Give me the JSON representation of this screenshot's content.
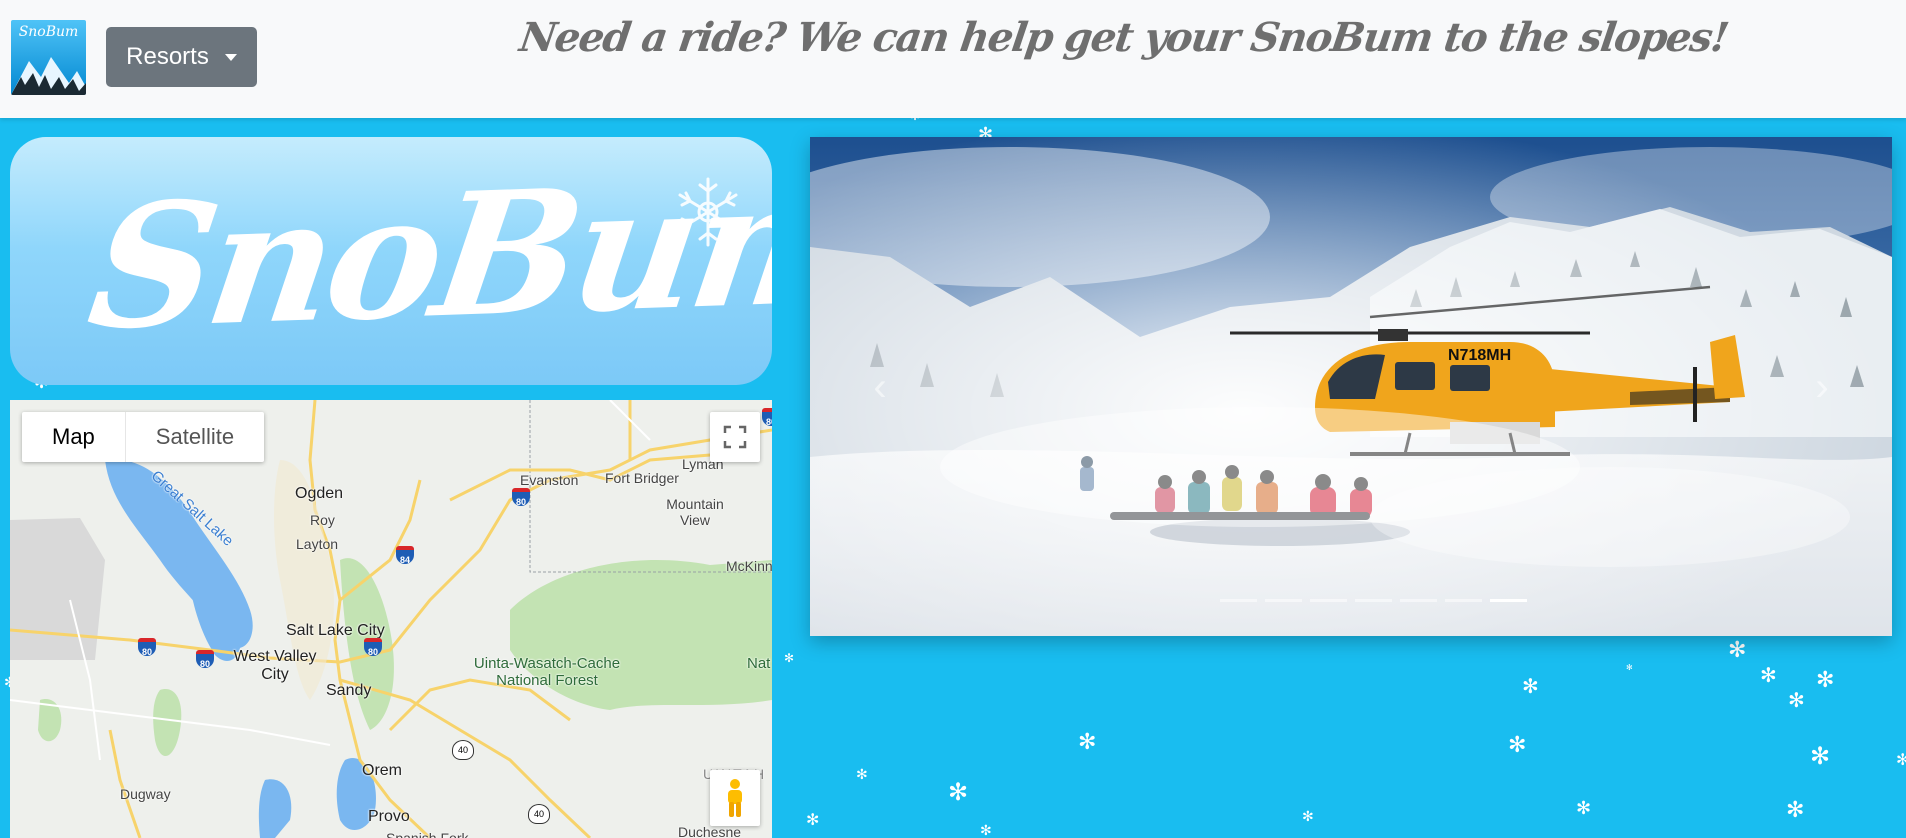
{
  "navbar": {
    "logo_text": "SnoBum",
    "resorts_label": "Resorts",
    "tagline": "Need a ride? We can help get your SnoBum to the slopes!"
  },
  "brand": {
    "name": "SnoBum"
  },
  "map": {
    "type_buttons": [
      "Map",
      "Satellite"
    ],
    "active_type": "Map",
    "labels": {
      "great_salt_lake": "Great Salt Lake",
      "ogden": "Ogden",
      "roy": "Roy",
      "layton": "Layton",
      "evanston": "Evanston",
      "fort_bridger": "Fort Bridger",
      "lyman": "Lyman",
      "mountain_view": "Mountain View",
      "mckinnon": "McKinn",
      "salt_lake_city": "Salt Lake City",
      "west_valley_city": "West Valley City",
      "sandy": "Sandy",
      "forest": "Uinta-Wasatch-Cache National Forest",
      "nat": "Nat",
      "orem": "Orem",
      "provo": "Provo",
      "dugway": "Dugway",
      "uintah": "UINTAH",
      "duchesne": "Duchesne",
      "spanish_fork": "Spanish Fork"
    },
    "shields": {
      "i80": "80",
      "i84": "84",
      "us40": "40"
    }
  },
  "carousel": {
    "slide_count": 7,
    "active_index": 6,
    "aircraft_id": "N718MH",
    "prev_label": "‹",
    "next_label": "›"
  },
  "colors": {
    "background": "#19bdf0",
    "navbar": "#f8f9fa",
    "button": "#6c757d",
    "helicopter": "#f0a51c"
  }
}
